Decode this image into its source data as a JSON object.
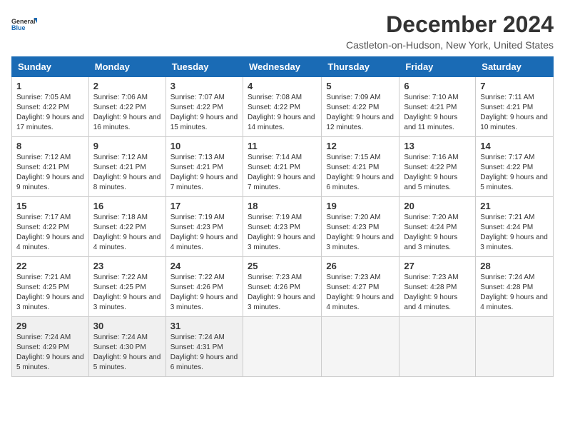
{
  "header": {
    "logo_general": "General",
    "logo_blue": "Blue",
    "month_title": "December 2024",
    "location": "Castleton-on-Hudson, New York, United States"
  },
  "days_of_week": [
    "Sunday",
    "Monday",
    "Tuesday",
    "Wednesday",
    "Thursday",
    "Friday",
    "Saturday"
  ],
  "weeks": [
    [
      {
        "day": "1",
        "sunrise": "7:05 AM",
        "sunset": "4:22 PM",
        "daylight": "9 hours and 17 minutes."
      },
      {
        "day": "2",
        "sunrise": "7:06 AM",
        "sunset": "4:22 PM",
        "daylight": "9 hours and 16 minutes."
      },
      {
        "day": "3",
        "sunrise": "7:07 AM",
        "sunset": "4:22 PM",
        "daylight": "9 hours and 15 minutes."
      },
      {
        "day": "4",
        "sunrise": "7:08 AM",
        "sunset": "4:22 PM",
        "daylight": "9 hours and 14 minutes."
      },
      {
        "day": "5",
        "sunrise": "7:09 AM",
        "sunset": "4:22 PM",
        "daylight": "9 hours and 12 minutes."
      },
      {
        "day": "6",
        "sunrise": "7:10 AM",
        "sunset": "4:21 PM",
        "daylight": "9 hours and 11 minutes."
      },
      {
        "day": "7",
        "sunrise": "7:11 AM",
        "sunset": "4:21 PM",
        "daylight": "9 hours and 10 minutes."
      }
    ],
    [
      {
        "day": "8",
        "sunrise": "7:12 AM",
        "sunset": "4:21 PM",
        "daylight": "9 hours and 9 minutes."
      },
      {
        "day": "9",
        "sunrise": "7:12 AM",
        "sunset": "4:21 PM",
        "daylight": "9 hours and 8 minutes."
      },
      {
        "day": "10",
        "sunrise": "7:13 AM",
        "sunset": "4:21 PM",
        "daylight": "9 hours and 7 minutes."
      },
      {
        "day": "11",
        "sunrise": "7:14 AM",
        "sunset": "4:21 PM",
        "daylight": "9 hours and 7 minutes."
      },
      {
        "day": "12",
        "sunrise": "7:15 AM",
        "sunset": "4:21 PM",
        "daylight": "9 hours and 6 minutes."
      },
      {
        "day": "13",
        "sunrise": "7:16 AM",
        "sunset": "4:22 PM",
        "daylight": "9 hours and 5 minutes."
      },
      {
        "day": "14",
        "sunrise": "7:17 AM",
        "sunset": "4:22 PM",
        "daylight": "9 hours and 5 minutes."
      }
    ],
    [
      {
        "day": "15",
        "sunrise": "7:17 AM",
        "sunset": "4:22 PM",
        "daylight": "9 hours and 4 minutes."
      },
      {
        "day": "16",
        "sunrise": "7:18 AM",
        "sunset": "4:22 PM",
        "daylight": "9 hours and 4 minutes."
      },
      {
        "day": "17",
        "sunrise": "7:19 AM",
        "sunset": "4:23 PM",
        "daylight": "9 hours and 4 minutes."
      },
      {
        "day": "18",
        "sunrise": "7:19 AM",
        "sunset": "4:23 PM",
        "daylight": "9 hours and 3 minutes."
      },
      {
        "day": "19",
        "sunrise": "7:20 AM",
        "sunset": "4:23 PM",
        "daylight": "9 hours and 3 minutes."
      },
      {
        "day": "20",
        "sunrise": "7:20 AM",
        "sunset": "4:24 PM",
        "daylight": "9 hours and 3 minutes."
      },
      {
        "day": "21",
        "sunrise": "7:21 AM",
        "sunset": "4:24 PM",
        "daylight": "9 hours and 3 minutes."
      }
    ],
    [
      {
        "day": "22",
        "sunrise": "7:21 AM",
        "sunset": "4:25 PM",
        "daylight": "9 hours and 3 minutes."
      },
      {
        "day": "23",
        "sunrise": "7:22 AM",
        "sunset": "4:25 PM",
        "daylight": "9 hours and 3 minutes."
      },
      {
        "day": "24",
        "sunrise": "7:22 AM",
        "sunset": "4:26 PM",
        "daylight": "9 hours and 3 minutes."
      },
      {
        "day": "25",
        "sunrise": "7:23 AM",
        "sunset": "4:26 PM",
        "daylight": "9 hours and 3 minutes."
      },
      {
        "day": "26",
        "sunrise": "7:23 AM",
        "sunset": "4:27 PM",
        "daylight": "9 hours and 4 minutes."
      },
      {
        "day": "27",
        "sunrise": "7:23 AM",
        "sunset": "4:28 PM",
        "daylight": "9 hours and 4 minutes."
      },
      {
        "day": "28",
        "sunrise": "7:24 AM",
        "sunset": "4:28 PM",
        "daylight": "9 hours and 4 minutes."
      }
    ],
    [
      {
        "day": "29",
        "sunrise": "7:24 AM",
        "sunset": "4:29 PM",
        "daylight": "9 hours and 5 minutes."
      },
      {
        "day": "30",
        "sunrise": "7:24 AM",
        "sunset": "4:30 PM",
        "daylight": "9 hours and 5 minutes."
      },
      {
        "day": "31",
        "sunrise": "7:24 AM",
        "sunset": "4:31 PM",
        "daylight": "9 hours and 6 minutes."
      },
      null,
      null,
      null,
      null
    ]
  ]
}
